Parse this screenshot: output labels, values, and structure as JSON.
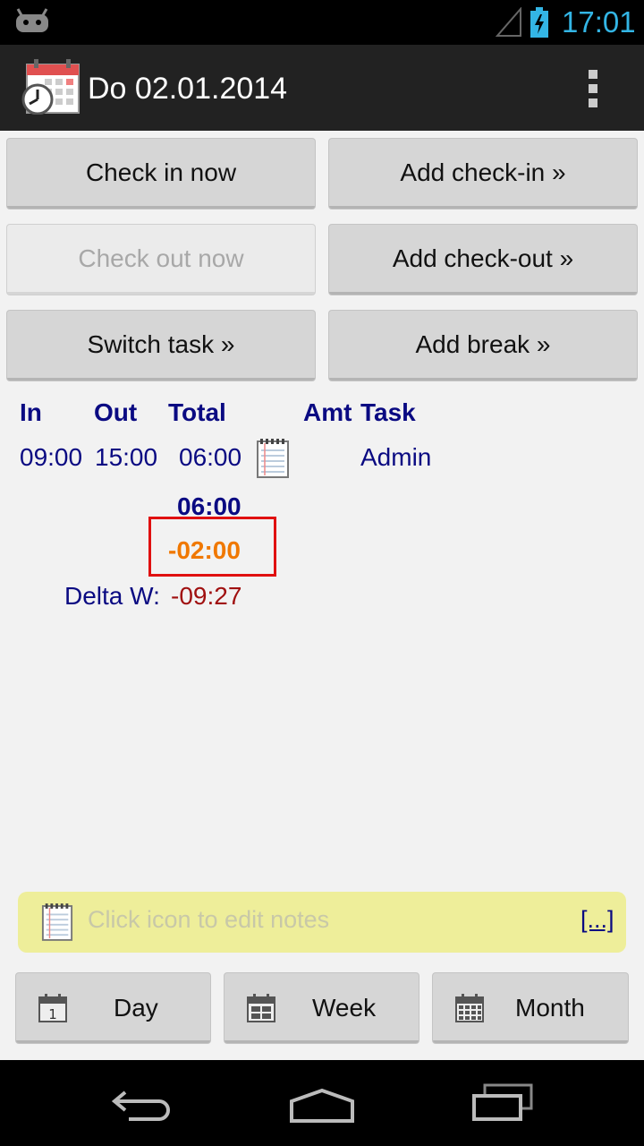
{
  "status_bar": {
    "time": "17:01"
  },
  "action_bar": {
    "title": "Do 02.01.2014"
  },
  "buttons": {
    "check_in_now": "Check in now",
    "add_check_in": "Add check-in »",
    "check_out_now": "Check out now",
    "add_check_out": "Add check-out »",
    "switch_task": "Switch task »",
    "add_break": "Add break »"
  },
  "table": {
    "headers": {
      "in": "In",
      "out": "Out",
      "total": "Total",
      "amt": "Amt",
      "task": "Task"
    },
    "rows": [
      {
        "in": "09:00",
        "out": "15:00",
        "total": "06:00",
        "task": "Admin"
      }
    ],
    "sum_total": "06:00",
    "difference": "-02:00",
    "delta_label": "Delta W:",
    "delta_value": "-09:27"
  },
  "notes": {
    "hint": "Click icon to edit notes",
    "more_link": "[...]"
  },
  "bottom_buttons": {
    "day": "Day",
    "week": "Week",
    "month": "Month"
  },
  "colors": {
    "accent": "#33b5e5",
    "text_blue": "#0a0a82",
    "orange": "#f07800",
    "dark_red": "#a01010",
    "notes_bg": "#eeee9a"
  }
}
